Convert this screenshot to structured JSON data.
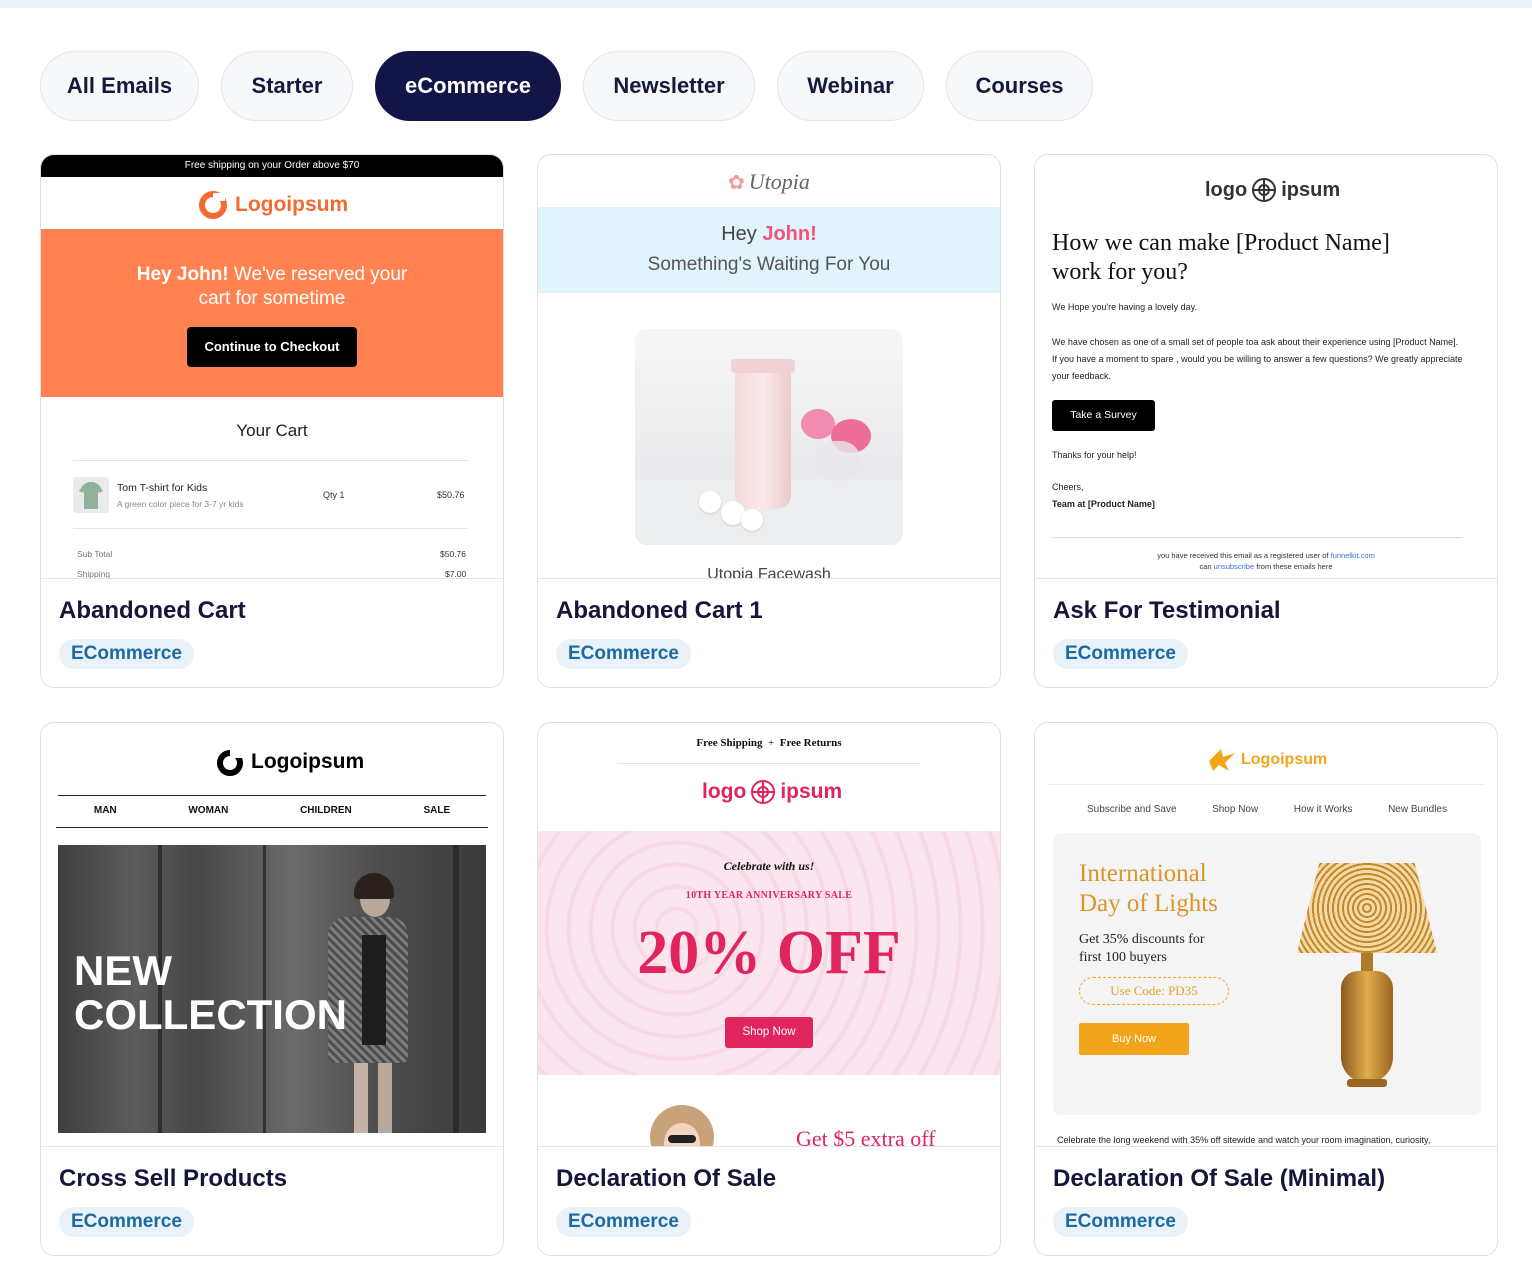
{
  "filters": [
    "All Emails",
    "Starter",
    "eCommerce",
    "Newsletter",
    "Webinar",
    "Courses"
  ],
  "active_filter": "eCommerce",
  "accent": "#121545",
  "cards": [
    {
      "title": "Abandoned Cart",
      "tag": "ECommerce",
      "p": {
        "ship": "Free shipping on your Order above $70",
        "logo": "Logoipsum",
        "hey": "Hey John!",
        "msg": " We've reserved your",
        "msg2": "cart for sometime",
        "btn": "Continue to Checkout",
        "cart": "Your Cart",
        "item": "Tom T-shirt for Kids",
        "desc": "A green color piece for 3-7 yr kids",
        "qty": "Qty 1",
        "price": "$50.76",
        "sub_label": "Sub Total",
        "sub": "$50.76",
        "ship_label": "Shipping",
        "ship_cost": "$7.00"
      }
    },
    {
      "title": "Abandoned Cart 1",
      "tag": "ECommerce",
      "p": {
        "brand": "Utopia",
        "hey": "Hey ",
        "name": "John!",
        "line2": "Something's Waiting For You",
        "product": "Utopia Facewash"
      }
    },
    {
      "title": "Ask For Testimonial",
      "tag": "ECommerce",
      "p": {
        "logo_left": "logo",
        "logo_right": "ipsum",
        "heading": "How we can make [Product Name] work for you?",
        "p1": "We Hope you're having a lovely day.",
        "p2": "We have chosen as one of a small set of people toa ask about their  experience using [Product Name]. If you have a moment to spare , would you be willing to answer a few questions? We greatly appreciate your feedback.",
        "btn": "Take a Survey",
        "thanks": "Thanks for your help!",
        "cheers": "Cheers,",
        "team": "Team at [Product Name]",
        "foot1": "you have received this email as a registered user of ",
        "foot_link": "funnelkit.com",
        "foot2a": "can ",
        "unsub": "unsubscribe",
        "foot2b": " from these emails here"
      }
    },
    {
      "title": "Cross Sell Products",
      "tag": "ECommerce",
      "p": {
        "logo": "Logoipsum",
        "nav": [
          "MAN",
          "WOMAN",
          "CHILDREN",
          "SALE"
        ],
        "hero1": "NEW",
        "hero2": "COLLECTION"
      }
    },
    {
      "title": "Declaration Of Sale",
      "tag": "ECommerce",
      "p": {
        "ship": "Free Shipping",
        "plus": "+",
        "returns": "Free Returns",
        "logo_left": "logo",
        "logo_right": "ipsum",
        "celebrate": "Celebrate with us!",
        "anniv": "10TH YEAR ANNIVERSARY SALE",
        "off": "20% OFF",
        "btn": "Shop Now",
        "extra": "Get $5 extra off"
      }
    },
    {
      "title": "Declaration Of Sale (Minimal)",
      "tag": "ECommerce",
      "p": {
        "logo": "Logoipsum",
        "nav": [
          "Subscribe and Save",
          "Shop Now",
          "How it Works",
          "New Bundles"
        ],
        "h1": "International",
        "h2": "Day of Lights",
        "d1": "Get 35% discounts for",
        "d2": "first 100 buyers",
        "code": "Use Code: PD35",
        "btn": "Buy Now",
        "foot": "Celebrate the long weekend with 35% off sitewide and watch your room imagination, curiosity,"
      }
    }
  ]
}
